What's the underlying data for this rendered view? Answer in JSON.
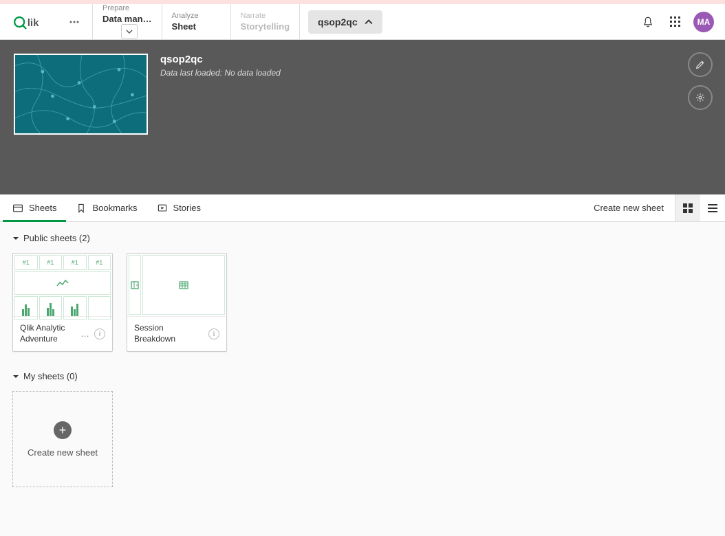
{
  "nav": {
    "prepare": {
      "sup": "Prepare",
      "main": "Data man…"
    },
    "analyze": {
      "sup": "Analyze",
      "main": "Sheet"
    },
    "narrate": {
      "sup": "Narrate",
      "main": "Storytelling"
    }
  },
  "app": {
    "name": "qsop2qc",
    "title": "qsop2qc",
    "meta": "Data last loaded: No data loaded"
  },
  "avatar": "MA",
  "subtabs": {
    "sheets": "Sheets",
    "bookmarks": "Bookmarks",
    "stories": "Stories"
  },
  "create_link": "Create new sheet",
  "sections": {
    "public": {
      "label": "Public sheets (2)",
      "count": 2
    },
    "my": {
      "label": "My sheets (0)",
      "count": 0
    }
  },
  "sheets": {
    "public": [
      {
        "title": "Qlik Analytic Adventure"
      },
      {
        "title": "Session Breakdown"
      }
    ]
  },
  "create_card": "Create new sheet",
  "pv1_tag": "#1"
}
